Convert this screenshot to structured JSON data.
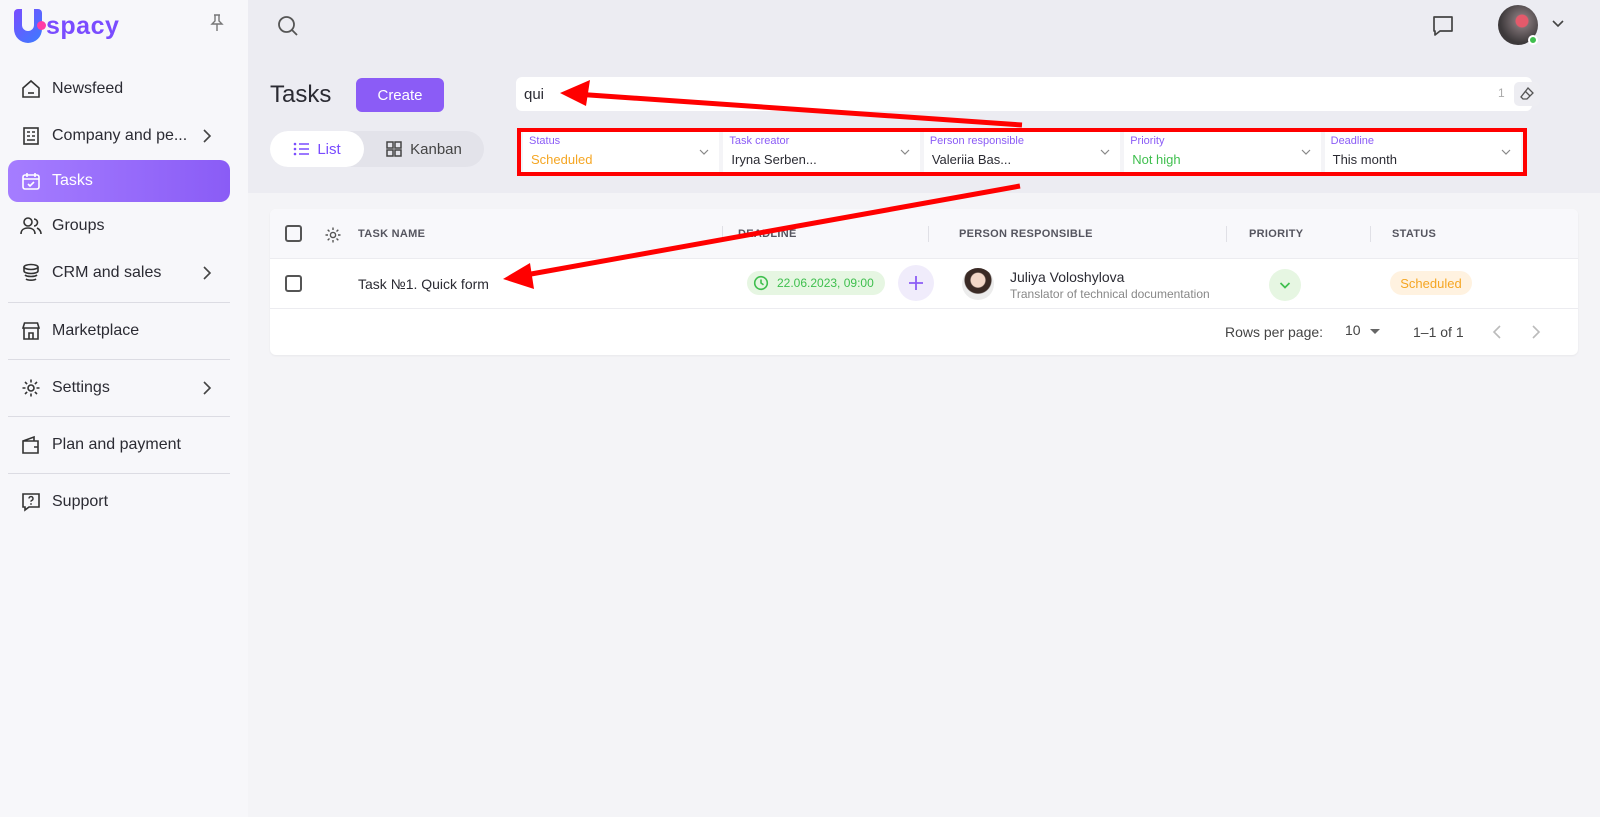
{
  "app": {
    "logo_text": "spacy",
    "brand_color": "#8b5cf6"
  },
  "sidebar": {
    "items": [
      {
        "label": "Newsfeed",
        "icon": "home-icon"
      },
      {
        "label": "Company and pe...",
        "icon": "building-icon",
        "has_submenu": true
      },
      {
        "label": "Tasks",
        "icon": "calendar-icon",
        "active": true
      },
      {
        "label": "Groups",
        "icon": "users-icon"
      },
      {
        "label": "CRM and sales",
        "icon": "database-icon",
        "has_submenu": true
      },
      {
        "label": "Marketplace",
        "icon": "store-icon"
      },
      {
        "label": "Settings",
        "icon": "gear-icon",
        "has_submenu": true
      },
      {
        "label": "Plan and payment",
        "icon": "wallet-icon"
      },
      {
        "label": "Support",
        "icon": "help-icon"
      }
    ]
  },
  "header": {
    "title": "Tasks",
    "create_label": "Create",
    "views": {
      "list": "List",
      "kanban": "Kanban"
    },
    "search": {
      "value": "qui",
      "count": "1"
    }
  },
  "filters": [
    {
      "label": "Status",
      "value": "Scheduled",
      "color": "#f5a623"
    },
    {
      "label": "Task creator",
      "value": "Iryna Serben..."
    },
    {
      "label": "Person responsible",
      "value": "Valeriia Bas..."
    },
    {
      "label": "Priority",
      "value": "Not high",
      "color": "#3fbf4e"
    },
    {
      "label": "Deadline",
      "value": "This month"
    }
  ],
  "table": {
    "columns": [
      "TASK NAME",
      "DEADLINE",
      "PERSON RESPONSIBLE",
      "PRIORITY",
      "STATUS"
    ],
    "rows": [
      {
        "task_name": "Task №1. Quick form",
        "deadline": "22.06.2023, 09:00",
        "person_name": "Juliya Voloshylova",
        "person_role": "Translator of technical documentation",
        "status": "Scheduled"
      }
    ],
    "pagination": {
      "rows_per_page_label": "Rows per page:",
      "rows_per_page": "10",
      "range": "1–1 of 1"
    }
  },
  "annotation_color": "#ff0000"
}
